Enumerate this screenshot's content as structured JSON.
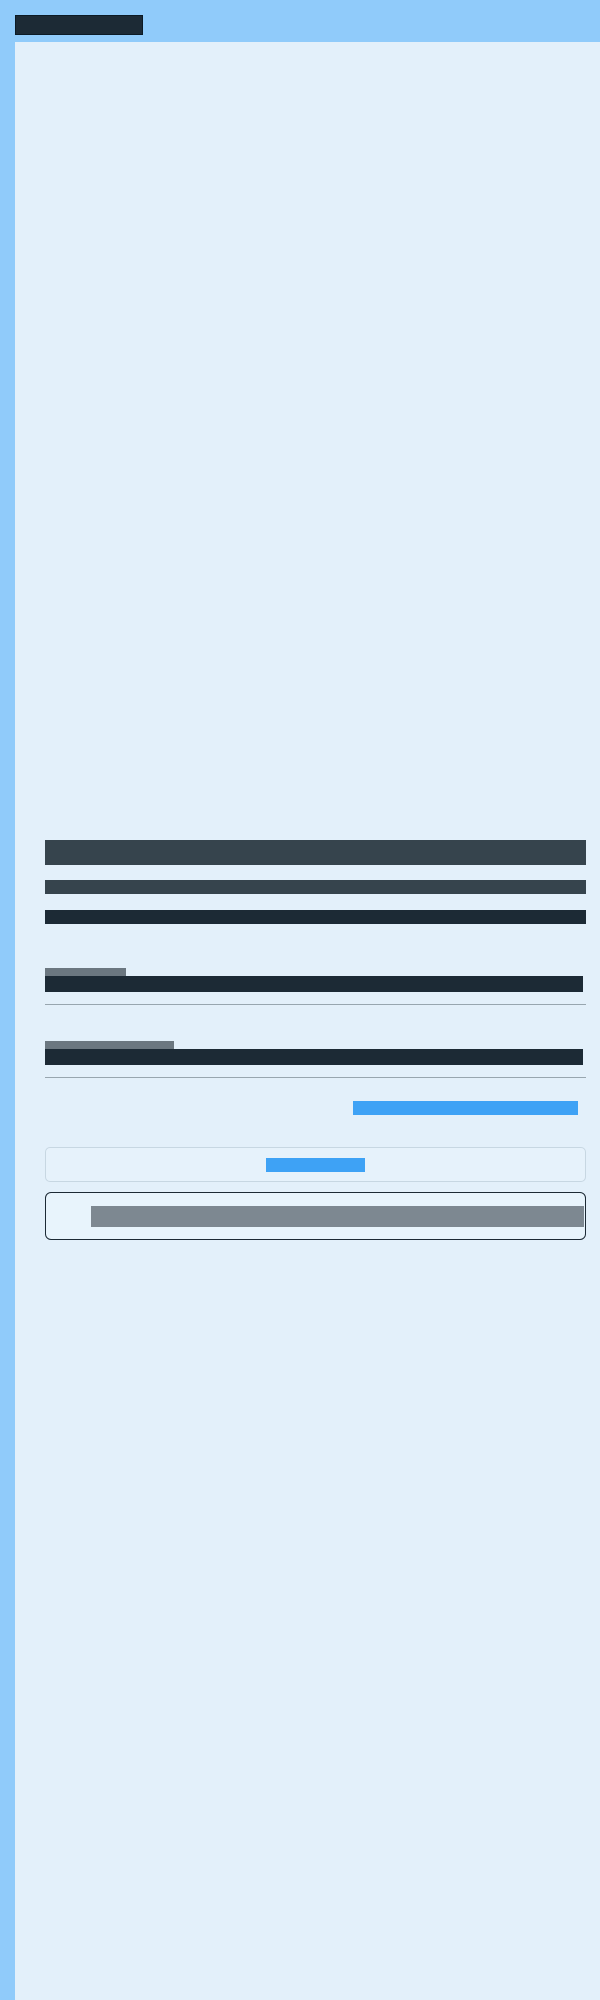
{
  "app": {
    "logo_text": ""
  },
  "main": {
    "heading": "",
    "subheading": "",
    "body_text": "",
    "field_1": {
      "label": "",
      "value": ""
    },
    "field_2": {
      "label": "",
      "value": ""
    },
    "link_text": "",
    "panel": {
      "button_label": ""
    },
    "footer": {
      "text": ""
    }
  },
  "colors": {
    "topbar": "#90cbfa",
    "background": "#e3f0fa",
    "dark_text": "#1c2a35",
    "heading_text": "#36444d",
    "muted_text": "#6b7780",
    "accent": "#3ea2f5",
    "footer_text": "#7d8891"
  }
}
